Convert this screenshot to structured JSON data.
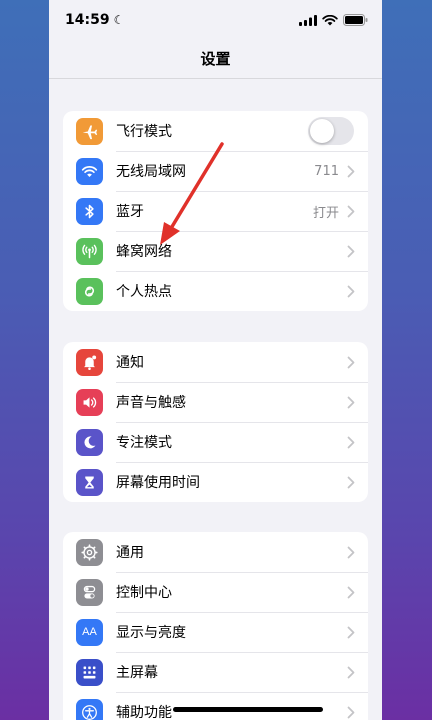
{
  "status_bar": {
    "time": "14:59",
    "moon": "☾"
  },
  "nav": {
    "title": "设置"
  },
  "groups": [
    {
      "rows": [
        {
          "label": "飞行模式",
          "icon": "airplane-icon",
          "color": "#f19a37",
          "toggle": false
        },
        {
          "label": "无线局域网",
          "icon": "wifi-icon",
          "color": "#3478f6",
          "value": "711"
        },
        {
          "label": "蓝牙",
          "icon": "bluetooth-icon",
          "color": "#3478f6",
          "value": "打开"
        },
        {
          "label": "蜂窝网络",
          "icon": "cellular-icon",
          "color": "#5ac15c"
        },
        {
          "label": "个人热点",
          "icon": "hotspot-icon",
          "color": "#5ac15c"
        }
      ]
    },
    {
      "rows": [
        {
          "label": "通知",
          "icon": "bell-icon",
          "color": "#e6463c"
        },
        {
          "label": "声音与触感",
          "icon": "speaker-icon",
          "color": "#e63f57"
        },
        {
          "label": "专注模式",
          "icon": "moon-icon",
          "color": "#5a54c9"
        },
        {
          "label": "屏幕使用时间",
          "icon": "hourglass-icon",
          "color": "#5a54c9"
        }
      ]
    },
    {
      "rows": [
        {
          "label": "通用",
          "icon": "gear-icon",
          "color": "#8e8e93"
        },
        {
          "label": "控制中心",
          "icon": "switches-icon",
          "color": "#8e8e93"
        },
        {
          "label": "显示与亮度",
          "icon": "text-size-icon",
          "color": "#3478f6",
          "glyph": "AA"
        },
        {
          "label": "主屏幕",
          "icon": "home-grid-icon",
          "color": "#3a4fc9"
        },
        {
          "label": "辅助功能",
          "icon": "accessibility-icon",
          "color": "#3478f6"
        }
      ]
    }
  ],
  "colors": {
    "arrow": "#e0312a",
    "background_top": "#3f6fb8",
    "background_bottom": "#6b2fa3"
  }
}
